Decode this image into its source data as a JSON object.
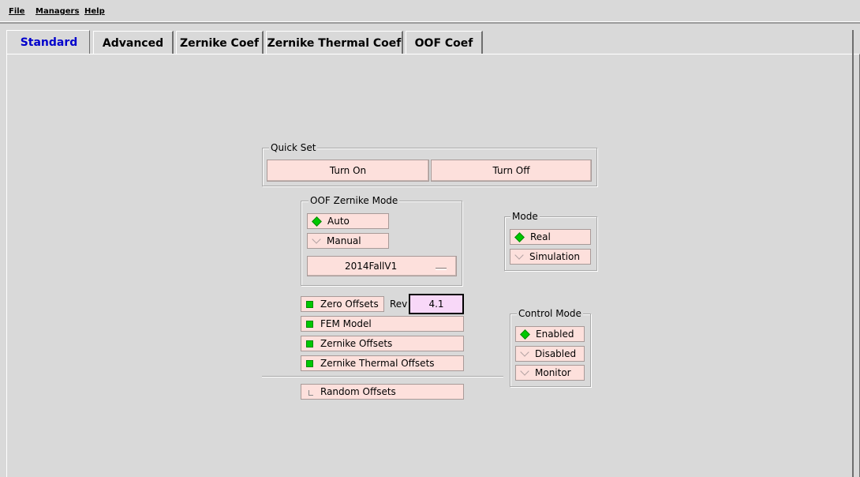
{
  "menubar": {
    "items": [
      {
        "label": "File"
      },
      {
        "label": "Managers"
      },
      {
        "label": "Help"
      }
    ]
  },
  "tabs": [
    {
      "label": "Standard",
      "active": true
    },
    {
      "label": "Advanced",
      "active": false
    },
    {
      "label": "Zernike Coef",
      "active": false
    },
    {
      "label": "Zernike Thermal Coef",
      "active": false
    },
    {
      "label": "OOF Coef",
      "active": false
    }
  ],
  "quick_set": {
    "title": "Quick Set",
    "turn_on_label": "Turn On",
    "turn_off_label": "Turn Off"
  },
  "oof_zernike_mode": {
    "title": "OOF Zernike Mode",
    "options": [
      {
        "label": "Auto",
        "selected": true
      },
      {
        "label": "Manual",
        "selected": false
      }
    ],
    "dropdown_value": "2014FallV1"
  },
  "mode": {
    "title": "Mode",
    "options": [
      {
        "label": "Real",
        "selected": true
      },
      {
        "label": "Simulation",
        "selected": false
      }
    ]
  },
  "offsets": {
    "zero_offsets": {
      "label": "Zero Offsets",
      "checked": true
    },
    "rev_label": "Rev",
    "rev_value": "4.1",
    "fem_model": {
      "label": "FEM Model",
      "checked": true
    },
    "zernike_offsets": {
      "label": "Zernike Offsets",
      "checked": true
    },
    "zernike_thermal_offsets": {
      "label": "Zernike Thermal Offsets",
      "checked": true
    },
    "random_offsets": {
      "label": "Random Offsets",
      "checked": false
    }
  },
  "control_mode": {
    "title": "Control Mode",
    "options": [
      {
        "label": "Enabled",
        "selected": true
      },
      {
        "label": "Disabled",
        "selected": false
      },
      {
        "label": "Monitor",
        "selected": false
      }
    ]
  },
  "colors": {
    "background": "#d9d9d9",
    "button_bg": "#fde0dc",
    "indicator_on": "#00c800",
    "active_tab_text": "#0000cc",
    "entry_bg": "#f8d8f8"
  }
}
